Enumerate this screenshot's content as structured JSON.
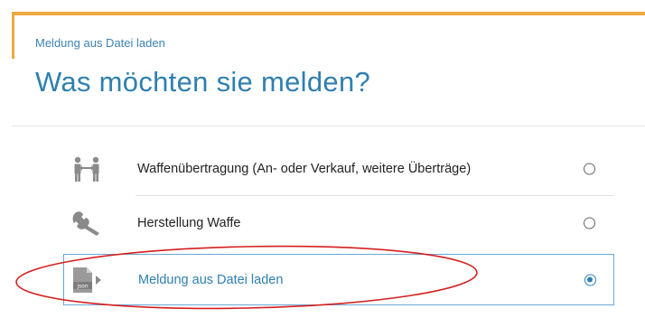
{
  "header": {
    "breadcrumb": "Meldung aus Datei laden",
    "title": "Was möchten sie melden?"
  },
  "options": [
    {
      "label": "Waffenübertragung (An- oder Verkauf, weitere Überträge)",
      "icon": "persons-transfer-icon",
      "selected": false
    },
    {
      "label": "Herstellung Waffe",
      "icon": "wrench-icon",
      "selected": false
    },
    {
      "label": "Meldung aus Datei laden",
      "icon": "json-file-icon",
      "icon_text": "json",
      "selected": true
    }
  ],
  "colors": {
    "accent_orange": "#f2a93b",
    "title_blue": "#2f7fb0",
    "icon_gray": "#8a8a8a",
    "highlight_red": "#d51f1f"
  }
}
